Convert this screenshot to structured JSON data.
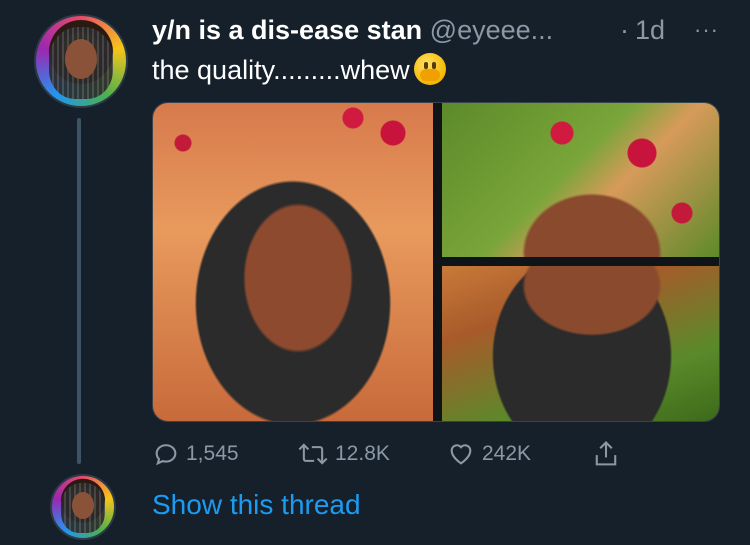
{
  "tweet": {
    "display_name": "y/n is a dis-ease stan",
    "handle": "@eyeee...",
    "separator": "·",
    "time": "1d",
    "more": "···",
    "text": "the quality.........whew",
    "emoji": "hand-over-mouth-emoji"
  },
  "stats": {
    "replies": "1,545",
    "retweets": "12.8K",
    "likes": "242K"
  },
  "show_thread": "Show this thread",
  "colors": {
    "background": "#15202b",
    "secondary_text": "#8b98a5",
    "link": "#1d9bf0",
    "thread_line": "#3d5466"
  }
}
